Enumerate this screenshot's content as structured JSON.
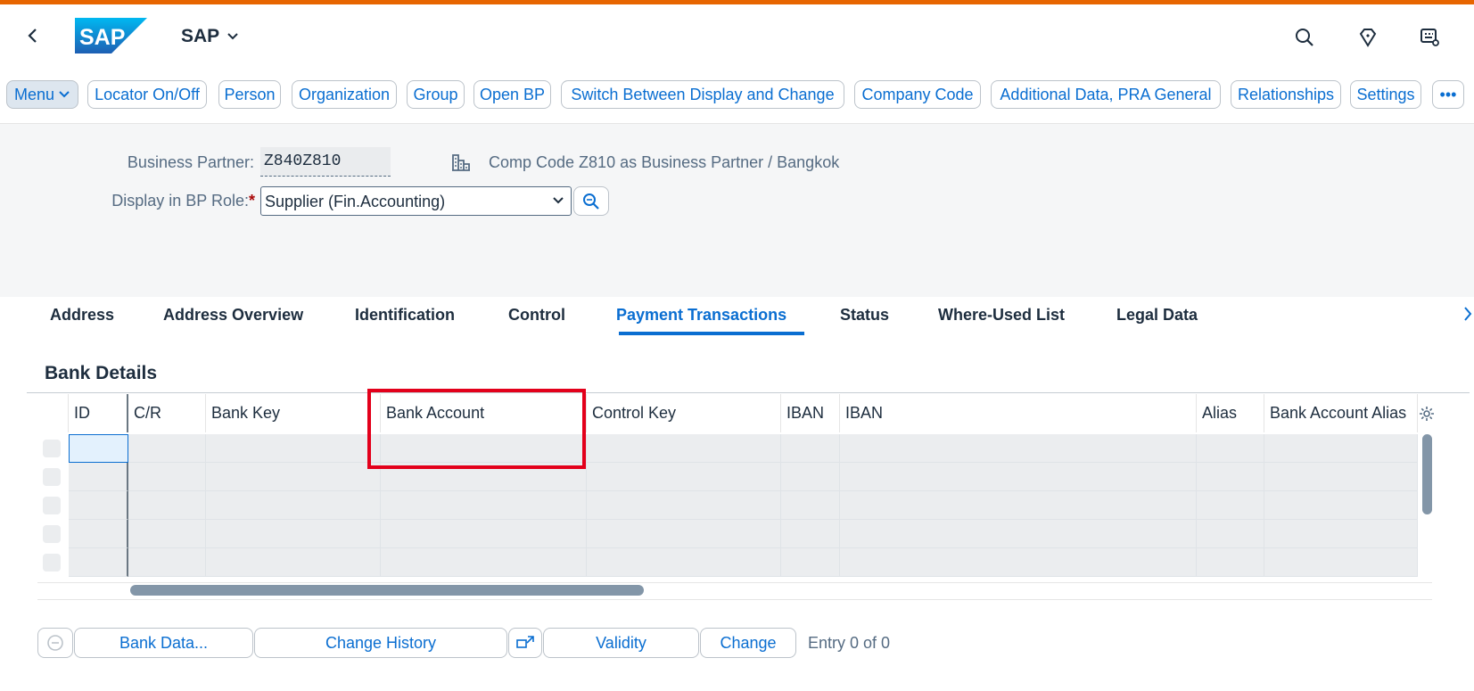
{
  "colors": {
    "accent": "#0a6ed1",
    "top_line": "#e76500",
    "highlight": "#e3001b"
  },
  "shell": {
    "title": "SAP",
    "logo_text": "SAP",
    "icons": [
      "back-icon",
      "search-icon",
      "diamond-icon",
      "settings-keys-icon"
    ]
  },
  "toolbar": {
    "menu": "Menu",
    "buttons": [
      "Locator On/Off",
      "Person",
      "Organization",
      "Group",
      "Open BP",
      "Switch Between Display and Change",
      "Company Code",
      "Additional Data, PRA General",
      "Relationships",
      "Settings"
    ],
    "overflow": "•••"
  },
  "header": {
    "bp_label": "Business Partner:",
    "bp_value": "Z840Z810",
    "bp_desc": "Comp Code Z810 as Business Partner / Bangkok",
    "role_label": "Display in BP Role:",
    "role_required": "*",
    "role_value": "Supplier (Fin.Accounting)"
  },
  "tabs": [
    "Address",
    "Address Overview",
    "Identification",
    "Control",
    "Payment Transactions",
    "Status",
    "Where-Used List",
    "Legal Data"
  ],
  "active_tab": "Payment Transactions",
  "bank": {
    "title": "Bank Details",
    "columns": [
      "ID",
      "C/R",
      "Bank Key",
      "Bank Account",
      "Control Key",
      "IBAN",
      "IBAN",
      "Alias",
      "Bank Account Alias"
    ],
    "rows": 5
  },
  "footer": {
    "bank_data": "Bank Data...",
    "change_history": "Change History",
    "validity": "Validity",
    "change": "Change",
    "entry": "Entry 0 of 0"
  }
}
